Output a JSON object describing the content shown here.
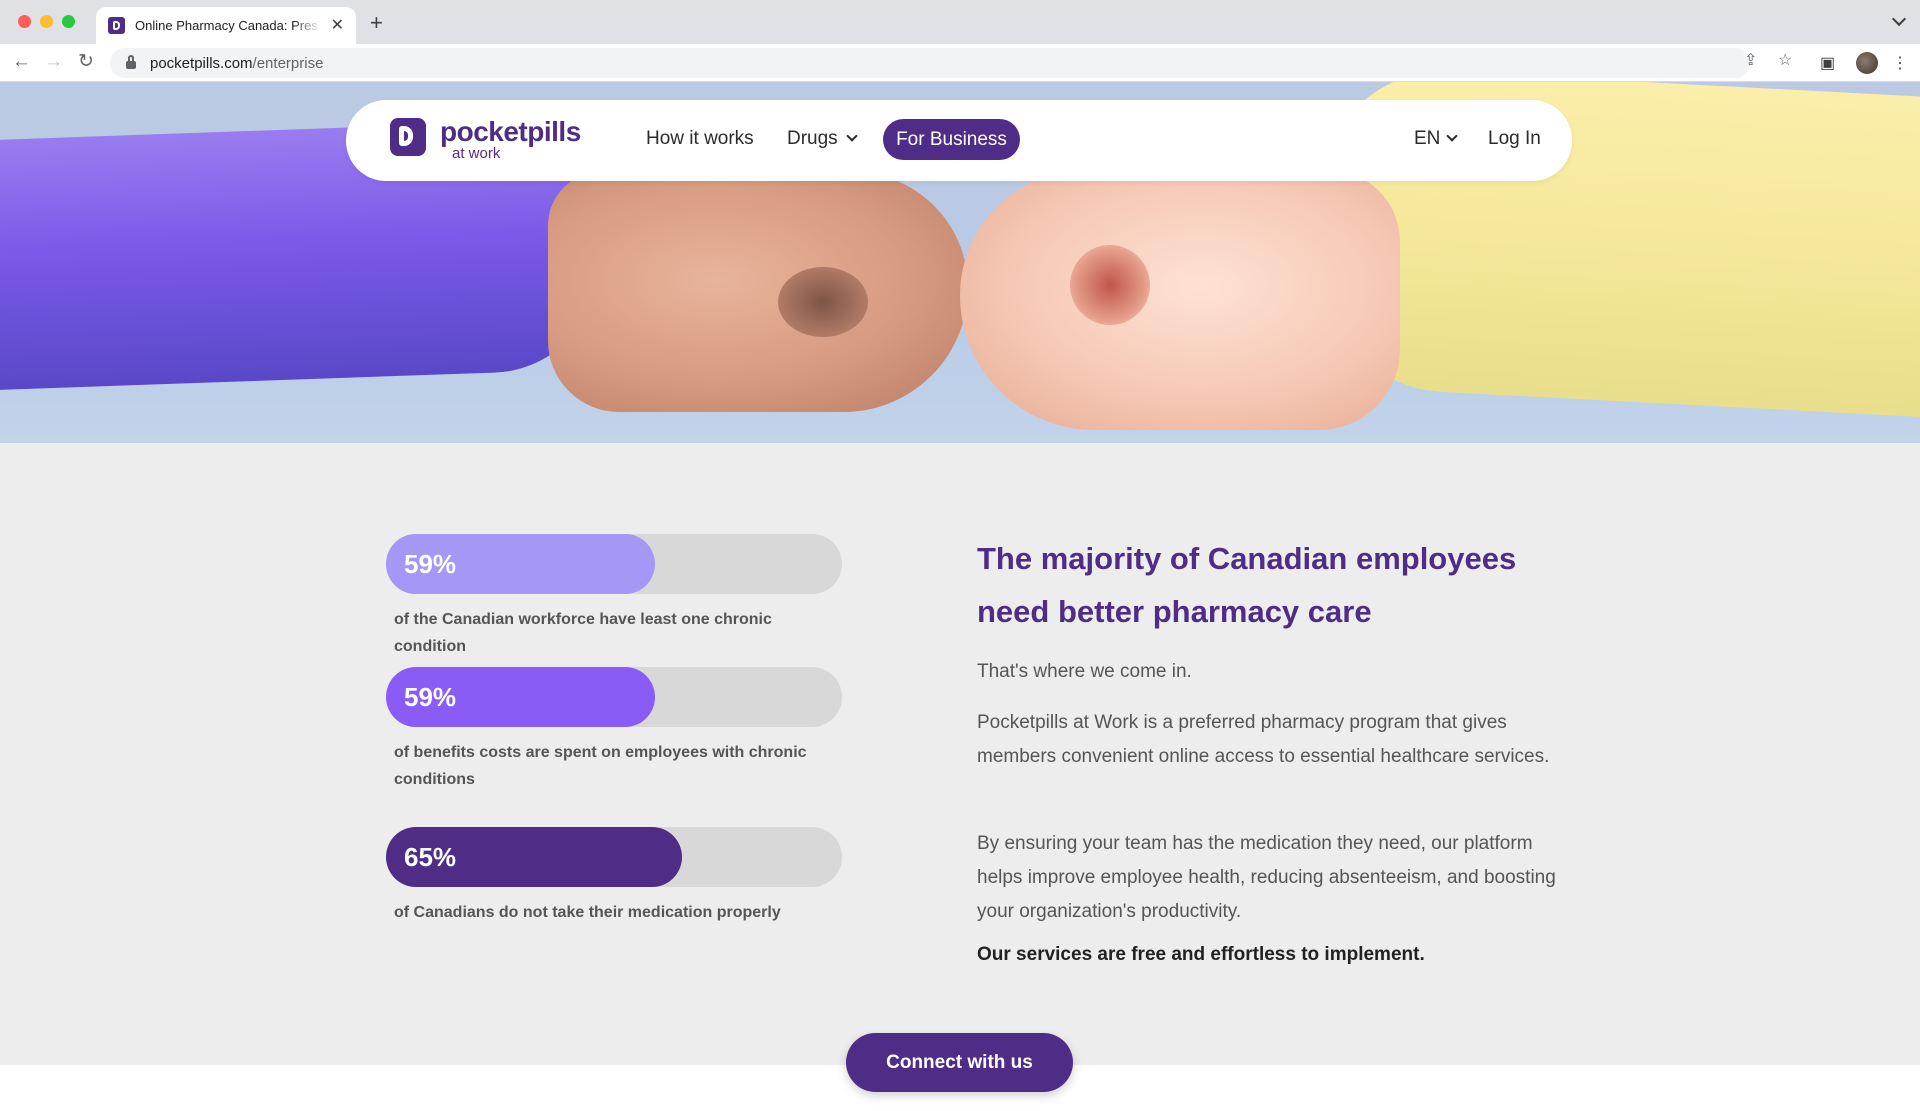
{
  "browser": {
    "tab_title": "Online Pharmacy Canada: Pres",
    "url_host": "pocketpills.com",
    "url_path": "/enterprise"
  },
  "header": {
    "logo_word": "pocketpills",
    "logo_sub": "at work",
    "nav": {
      "how_it_works": "How it works",
      "drugs": "Drugs",
      "for_business": "For Business",
      "language": "EN",
      "login": "Log In"
    }
  },
  "stats": [
    {
      "value": "59%",
      "caption": "of the Canadian workforce have least one chronic condition",
      "fill_percent": 59,
      "color": "#a497f5"
    },
    {
      "value": "59%",
      "caption": "of benefits costs are spent on employees with chronic conditions",
      "fill_percent": 59,
      "color": "#8a5cf6"
    },
    {
      "value": "65%",
      "caption": "of Canadians do not take their medication properly",
      "fill_percent": 65,
      "color": "#4f2c86"
    }
  ],
  "content": {
    "heading": "The majority of Canadian employees need better pharmacy care",
    "p1": "That's where we come in.",
    "p2": "Pocketpills at Work is a preferred pharmacy program that gives members convenient online access to essential healthcare services.",
    "p3": "By ensuring your team has the medication they need, our platform helps improve employee health, reducing absenteeism, and boosting your organization's productivity.",
    "p4": "Our services are free and effortless to implement."
  },
  "cta": {
    "label": "Connect with us"
  },
  "colors": {
    "brand": "#4f2c86"
  }
}
